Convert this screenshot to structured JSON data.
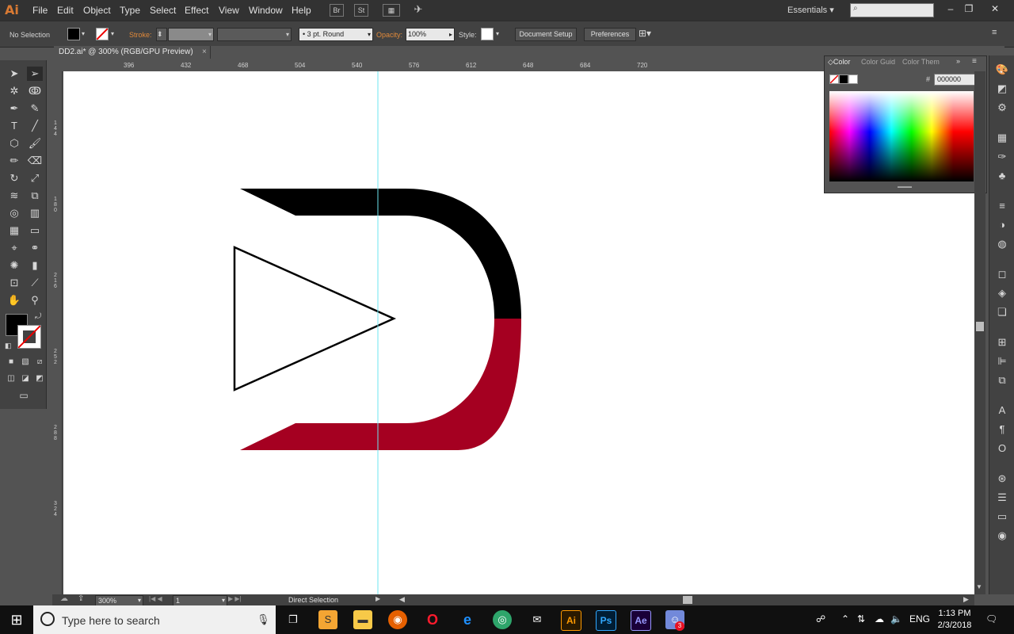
{
  "menubar": {
    "logo": "Ai",
    "items": [
      "File",
      "Edit",
      "Object",
      "Type",
      "Select",
      "Effect",
      "View",
      "Window",
      "Help"
    ],
    "workspace": "Essentials",
    "window_controls": [
      "minimize",
      "restore",
      "close"
    ]
  },
  "control": {
    "selection": "No Selection",
    "stroke_label": "Stroke:",
    "brush": "3 pt. Round",
    "opacity_label": "Opacity:",
    "opacity_value": "100%",
    "style_label": "Style:",
    "document_setup": "Document Setup",
    "preferences": "Preferences"
  },
  "tab": {
    "title": "DD2.ai* @ 300% (RGB/GPU Preview)",
    "close": "×"
  },
  "ruler": {
    "h_ticks": [
      "396",
      "432",
      "468",
      "504",
      "540",
      "576",
      "612",
      "648",
      "684",
      "720"
    ],
    "v_ticks": [
      "1\n4\n4",
      "1\n8\n0",
      "2\n1\n6",
      "2\n5\n2",
      "2\n8\n8",
      "3\n2\n4"
    ]
  },
  "color_panel": {
    "tabs": [
      "Color",
      "Color Guid",
      "Color Them"
    ],
    "hex_value": "000000",
    "hash": "#",
    "fill_color": "#000000"
  },
  "status": {
    "zoom": "300%",
    "page": "1",
    "tool": "Direct Selection"
  },
  "artwork": {
    "top_color": "#000000",
    "bottom_color": "#a50021",
    "guide_color": "#6ee6f0",
    "triangle_stroke": "#000000"
  },
  "taskbar": {
    "search_placeholder": "Type here to search",
    "language": "ENG",
    "time": "1:13 PM",
    "date": "2/3/2018",
    "apps": [
      "task-view",
      "sublime",
      "file-explorer",
      "firefox",
      "opera",
      "edge",
      "chrome-like",
      "mail",
      "illustrator",
      "photoshop",
      "after-effects",
      "discord"
    ],
    "app_labels": {
      "illustrator": "Ai",
      "photoshop": "Ps",
      "after_effects": "Ae"
    },
    "notification_badge": "3"
  }
}
